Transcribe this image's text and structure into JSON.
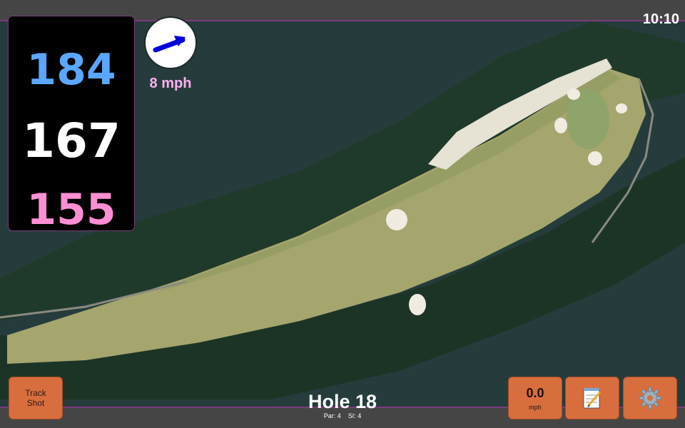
{
  "status": {
    "time": "10:10"
  },
  "distances": {
    "back": "184",
    "middle": "167",
    "front": "155"
  },
  "wind": {
    "speed": "8 mph",
    "arrow_icon": "wind-direction-arrow-icon",
    "arrow_color": "#0000e0"
  },
  "hole": {
    "title": "Hole 18",
    "par": "Par: 4",
    "stroke_index": "SI: 4"
  },
  "buttons": {
    "track_shot": "Track Shot",
    "speed_value": "0.0",
    "speed_unit": "mph",
    "notes_icon": "notepad-icon",
    "settings_icon": "gear-icon"
  },
  "colors": {
    "back_distance": "#5aa7ff",
    "middle_distance": "#ffffff",
    "front_distance": "#ff8fd4",
    "button_bg": "#d86e3d",
    "bar_accent": "#7a3a7a"
  }
}
